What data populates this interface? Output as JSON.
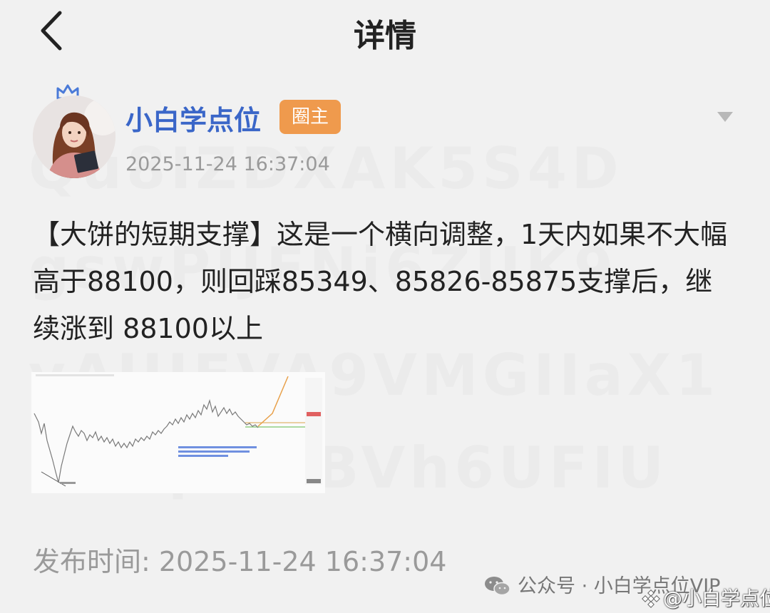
{
  "header": {
    "title": "详情"
  },
  "post": {
    "author": "小白学点位",
    "author_badge": "圈主",
    "timestamp": "2025-11-24 16:37:04",
    "content": "【大饼的短期支撑】这是一个横向调整，1天内如果不大幅高于88100，则回踩85349、85826-85875支撑后，继续涨到 88100以上",
    "publish_label": "发布时间: 2025-11-24 16:37:04"
  },
  "footer": {
    "source": "公众号 · 小白学点位VIP",
    "watermark": "@小白学点位"
  },
  "colors": {
    "background": "#f1f1f1",
    "author_link": "#3a66c8",
    "badge": "#ef9a4d",
    "muted_text": "#9a9a9a"
  },
  "icons": [
    "back-arrow-icon",
    "crown-icon",
    "dropdown-caret-icon",
    "wechat-icon",
    "binance-icon"
  ]
}
